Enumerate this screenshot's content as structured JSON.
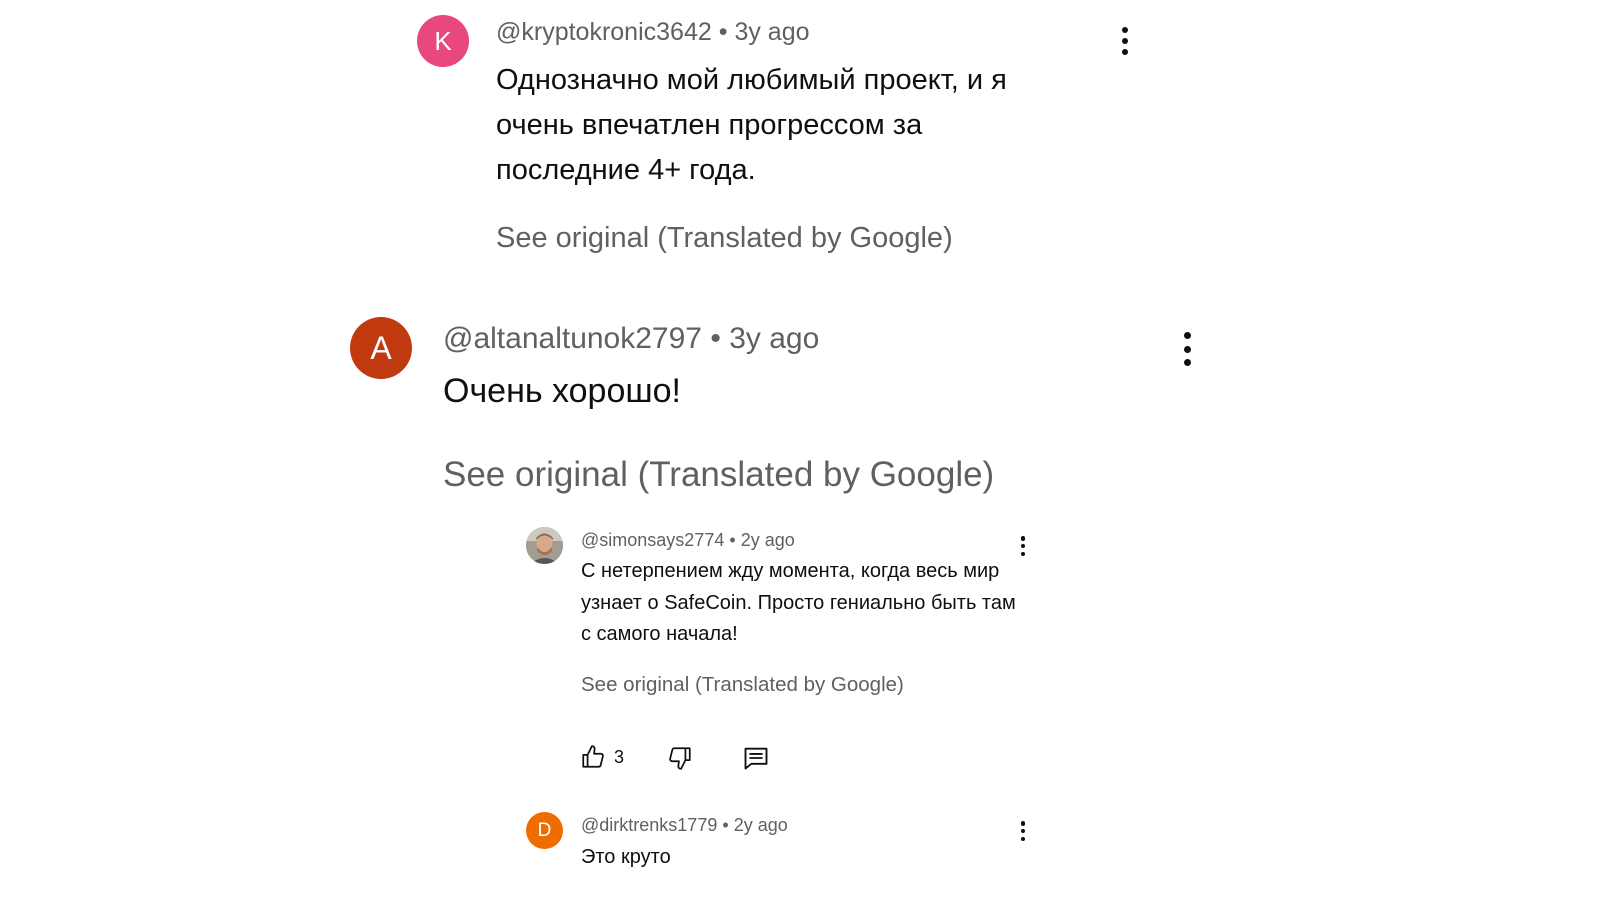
{
  "comments": [
    {
      "avatar_letter": "K",
      "avatar_color": "#e8487e",
      "handle": "@kryptokronic3642",
      "separator": "•",
      "time": "3y ago",
      "text": "Однозначно мой любимый проект, и я очень впечатлен прогрессом за последние 4+ года.",
      "see_original": "See original (Translated by Google)"
    },
    {
      "avatar_letter": "A",
      "avatar_color": "#c0390f",
      "handle": "@altanaltunok2797",
      "separator": "•",
      "time": "3y ago",
      "text": "Очень хорошо!",
      "see_original": "See original (Translated by Google)"
    }
  ],
  "replies": [
    {
      "avatar_type": "photo",
      "handle": "@simonsays2774",
      "separator": "•",
      "time": "2y ago",
      "text": "С нетерпением жду момента, когда весь мир узнает о SafeCoin. Просто гениально быть там с самого начала!",
      "see_original": "See original (Translated by Google)",
      "like_count": "3"
    },
    {
      "avatar_letter": "D",
      "avatar_color": "#ef6c00",
      "handle": "@dirktrenks1779",
      "separator": "•",
      "time": "2y ago",
      "text": "Это круто"
    }
  ],
  "icons": {
    "more": "more-vert-icon",
    "like": "thumbs-up-icon",
    "dislike": "thumbs-down-icon",
    "reply": "comment-icon"
  }
}
